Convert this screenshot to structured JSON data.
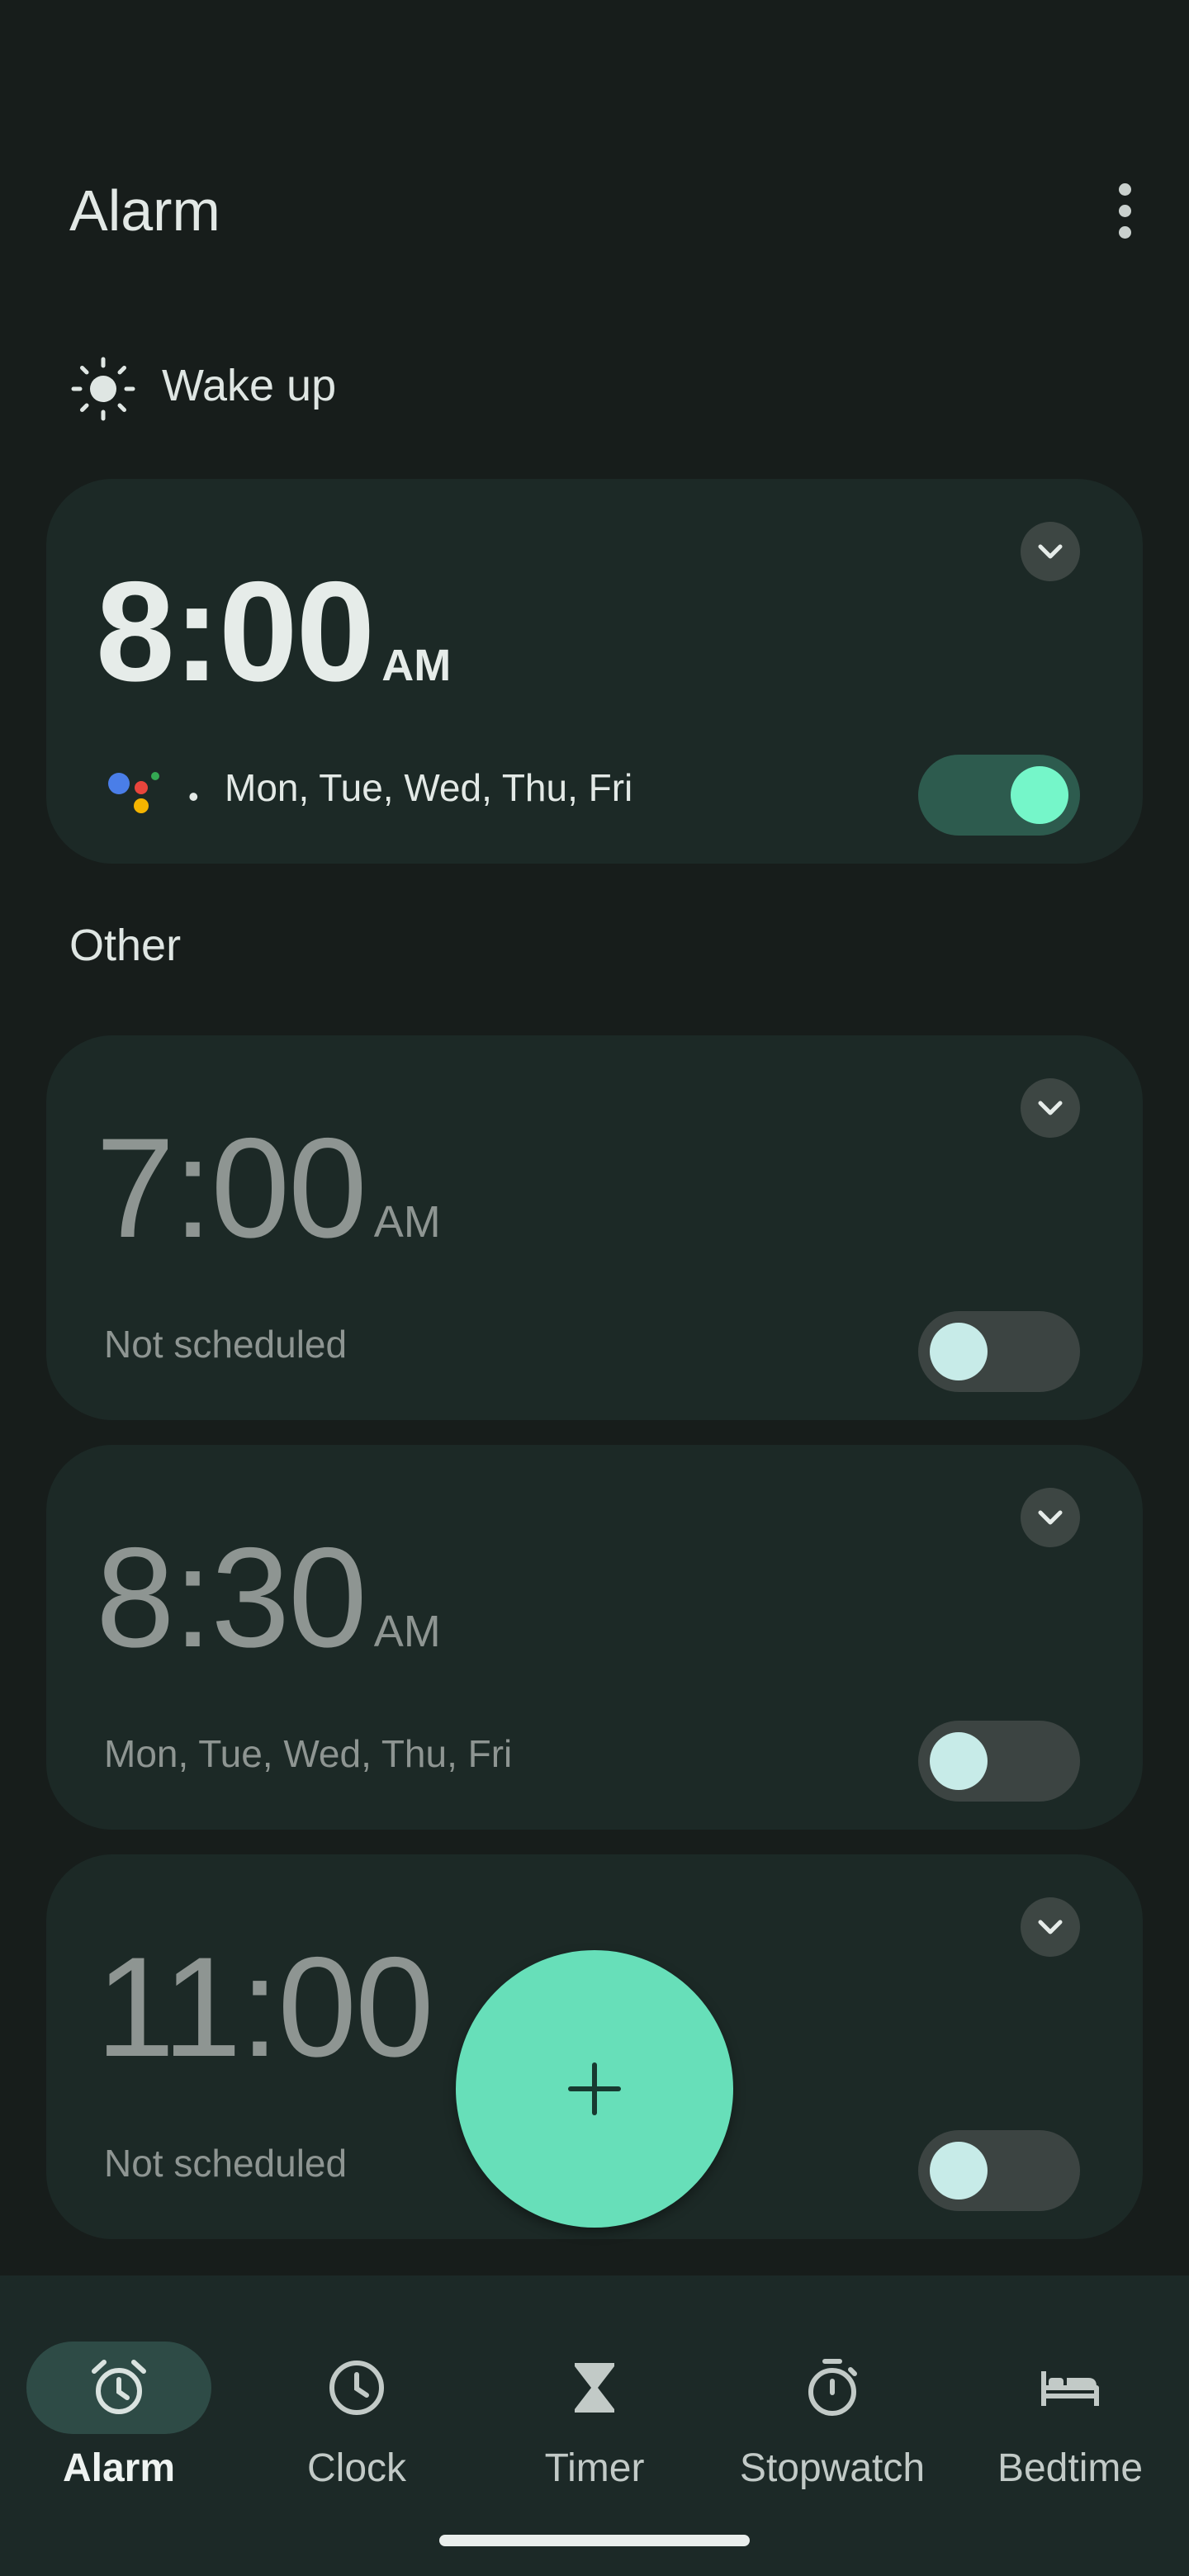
{
  "header": {
    "title": "Alarm",
    "more_icon": "more-vert-icon"
  },
  "sections": {
    "wake_up": {
      "label": "Wake up",
      "icon": "sun-icon"
    },
    "other": {
      "label": "Other"
    }
  },
  "alarms": [
    {
      "time": "8:00",
      "ampm": "AM",
      "schedule": "Mon, Tue, Wed, Thu, Fri",
      "enabled": true,
      "assistant": true
    },
    {
      "time": "7:00",
      "ampm": "AM",
      "schedule": "Not scheduled",
      "enabled": false
    },
    {
      "time": "8:30",
      "ampm": "AM",
      "schedule": "Mon, Tue, Wed, Thu, Fri",
      "enabled": false
    },
    {
      "time": "11:00",
      "ampm": "",
      "schedule": "Not scheduled",
      "enabled": false
    }
  ],
  "fab": {
    "icon": "add-icon"
  },
  "bottom_nav": {
    "items": [
      {
        "label": "Alarm",
        "icon": "alarm-icon",
        "selected": true
      },
      {
        "label": "Clock",
        "icon": "clock-icon",
        "selected": false
      },
      {
        "label": "Timer",
        "icon": "hourglass-icon",
        "selected": false
      },
      {
        "label": "Stopwatch",
        "icon": "stopwatch-icon",
        "selected": false
      },
      {
        "label": "Bedtime",
        "icon": "bed-icon",
        "selected": false
      }
    ]
  },
  "colors": {
    "background": "#171d1b",
    "card": "#1c2926",
    "accent": "#67dfb9",
    "toggle_on_knob": "#75f6c9",
    "toggle_on_track": "#2d5b4e"
  }
}
